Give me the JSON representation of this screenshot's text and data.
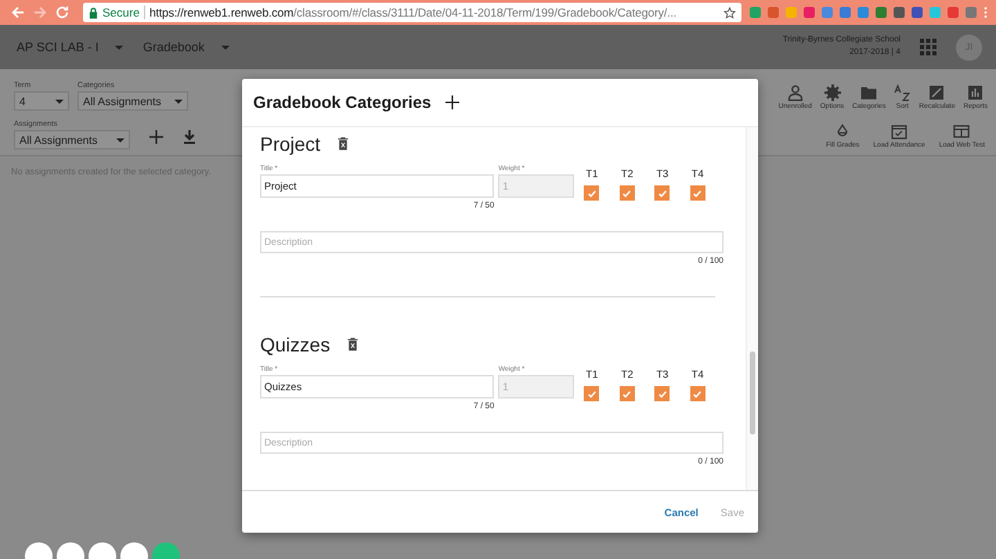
{
  "browser": {
    "secure_label": "Secure",
    "url_host": "https://renweb1.renweb.com",
    "url_path": "/classroom/#/class/3111/Date/04-11-2018/Term/199/Gradebook/Category/..."
  },
  "app_header": {
    "class_menu": "AP SCI LAB - I",
    "section_menu": "Gradebook",
    "school": "Trinity-Byrnes Collegiate School",
    "year": "2017-2018 | 4",
    "avatar": "JI"
  },
  "filters": [
    {
      "label": "Term",
      "value": "4"
    },
    {
      "label": "Categories",
      "value": "All Assignments"
    }
  ],
  "assignments_filter": {
    "label": "Assignments",
    "value": "All Assignments"
  },
  "toolbar": [
    "Unenrolled",
    "Options",
    "Categories",
    "Sort",
    "Recalculate",
    "Reports"
  ],
  "toolbar_secondary": [
    "Fill Grades",
    "Load Attendance",
    "Load Web Test"
  ],
  "empty_message": "No assignments created for the selected category.",
  "dialog": {
    "title": "Gradebook Categories",
    "categories": [
      {
        "heading": "Project",
        "title_label": "Title *",
        "title_value": "Project",
        "title_count": "7 / 50",
        "weight_label": "Weight *",
        "weight_value": "1",
        "terms": [
          {
            "label": "T1",
            "checked": true
          },
          {
            "label": "T2",
            "checked": true
          },
          {
            "label": "T3",
            "checked": true
          },
          {
            "label": "T4",
            "checked": true
          }
        ],
        "description_placeholder": "Description",
        "description_count": "0 / 100"
      },
      {
        "heading": "Quizzes",
        "title_label": "Title *",
        "title_value": "Quizzes",
        "title_count": "7 / 50",
        "weight_label": "Weight *",
        "weight_value": "1",
        "terms": [
          {
            "label": "T1",
            "checked": true
          },
          {
            "label": "T2",
            "checked": true
          },
          {
            "label": "T3",
            "checked": true
          },
          {
            "label": "T4",
            "checked": true
          }
        ],
        "description_placeholder": "Description",
        "description_count": "0 / 100"
      }
    ],
    "buttons": [
      {
        "label": "Cancel",
        "disabled": false
      },
      {
        "label": "Save",
        "disabled": true
      }
    ]
  }
}
